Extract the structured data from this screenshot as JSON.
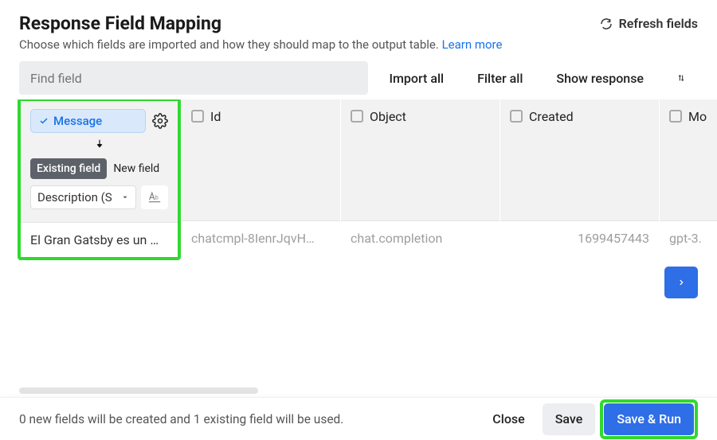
{
  "header": {
    "title": "Response Field Mapping",
    "refresh_label": "Refresh fields"
  },
  "subtitle": {
    "text": "Choose which fields are imported and how they should map to the output table.",
    "link_label": "Learn more"
  },
  "toolbar": {
    "find_placeholder": "Find field",
    "import_all": "Import all",
    "filter_all": "Filter all",
    "show_response": "Show response"
  },
  "columns": [
    {
      "name": "Message",
      "active": true,
      "toggle": {
        "existing": "Existing field",
        "new": "New field"
      },
      "dest_label": "Description (S",
      "value": "El Gran Gatsby es un …"
    },
    {
      "name": "Id",
      "value": "chatcmpl-8IenrJqvH…"
    },
    {
      "name": "Object",
      "value": "chat.completion"
    },
    {
      "name": "Created",
      "value": "1699457443",
      "align": "right"
    },
    {
      "name": "Mo",
      "value": "gpt-3."
    }
  ],
  "footer": {
    "note": "0 new fields will be created and 1 existing field will be used.",
    "close": "Close",
    "save": "Save",
    "run": "Save & Run"
  }
}
